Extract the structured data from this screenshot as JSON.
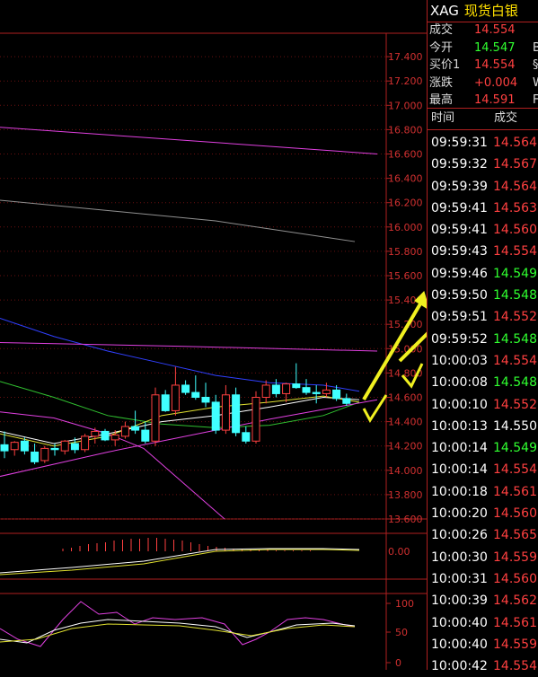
{
  "chart_data": {
    "type": "candlestick",
    "y_ticks": [
      "17.400",
      "17.200",
      "17.000",
      "16.800",
      "16.600",
      "16.400",
      "16.200",
      "16.000",
      "15.800",
      "15.600",
      "15.400",
      "15.200",
      "15.000",
      "14.800",
      "14.600",
      "14.400",
      "14.200",
      "14.000",
      "13.800",
      "13.600"
    ],
    "ylim": [
      13.6,
      17.5
    ],
    "candles": [
      {
        "o": 14.21,
        "h": 14.32,
        "l": 14.1,
        "c": 14.16
      },
      {
        "o": 14.17,
        "h": 14.24,
        "l": 14.12,
        "c": 14.23
      },
      {
        "o": 14.24,
        "h": 14.27,
        "l": 14.13,
        "c": 14.16
      },
      {
        "o": 14.15,
        "h": 14.22,
        "l": 14.05,
        "c": 14.07
      },
      {
        "o": 14.08,
        "h": 14.2,
        "l": 14.06,
        "c": 14.18
      },
      {
        "o": 14.18,
        "h": 14.22,
        "l": 14.12,
        "c": 14.17
      },
      {
        "o": 14.16,
        "h": 14.25,
        "l": 14.13,
        "c": 14.24
      },
      {
        "o": 14.22,
        "h": 14.27,
        "l": 14.14,
        "c": 14.17
      },
      {
        "o": 14.17,
        "h": 14.3,
        "l": 14.15,
        "c": 14.28
      },
      {
        "o": 14.28,
        "h": 14.35,
        "l": 14.22,
        "c": 14.32
      },
      {
        "o": 14.32,
        "h": 14.34,
        "l": 14.24,
        "c": 14.25
      },
      {
        "o": 14.25,
        "h": 14.33,
        "l": 14.2,
        "c": 14.29
      },
      {
        "o": 14.28,
        "h": 14.4,
        "l": 14.26,
        "c": 14.36
      },
      {
        "o": 14.36,
        "h": 14.49,
        "l": 14.3,
        "c": 14.33
      },
      {
        "o": 14.33,
        "h": 14.4,
        "l": 14.22,
        "c": 14.24
      },
      {
        "o": 14.24,
        "h": 14.68,
        "l": 14.2,
        "c": 14.62
      },
      {
        "o": 14.62,
        "h": 14.66,
        "l": 14.48,
        "c": 14.49
      },
      {
        "o": 14.49,
        "h": 14.85,
        "l": 14.45,
        "c": 14.7
      },
      {
        "o": 14.7,
        "h": 14.74,
        "l": 14.62,
        "c": 14.64
      },
      {
        "o": 14.64,
        "h": 14.78,
        "l": 14.58,
        "c": 14.6
      },
      {
        "o": 14.6,
        "h": 14.72,
        "l": 14.52,
        "c": 14.56
      },
      {
        "o": 14.56,
        "h": 14.62,
        "l": 14.3,
        "c": 14.33
      },
      {
        "o": 14.33,
        "h": 14.7,
        "l": 14.3,
        "c": 14.62
      },
      {
        "o": 14.62,
        "h": 14.68,
        "l": 14.28,
        "c": 14.31
      },
      {
        "o": 14.31,
        "h": 14.36,
        "l": 14.22,
        "c": 14.24
      },
      {
        "o": 14.24,
        "h": 14.65,
        "l": 14.22,
        "c": 14.6
      },
      {
        "o": 14.6,
        "h": 14.74,
        "l": 14.55,
        "c": 14.7
      },
      {
        "o": 14.7,
        "h": 14.75,
        "l": 14.6,
        "c": 14.63
      },
      {
        "o": 14.63,
        "h": 14.72,
        "l": 14.56,
        "c": 14.71
      },
      {
        "o": 14.71,
        "h": 14.88,
        "l": 14.67,
        "c": 14.68
      },
      {
        "o": 14.68,
        "h": 14.75,
        "l": 14.62,
        "c": 14.64
      },
      {
        "o": 14.64,
        "h": 14.7,
        "l": 14.55,
        "c": 14.63
      },
      {
        "o": 14.63,
        "h": 14.72,
        "l": 14.6,
        "c": 14.66
      },
      {
        "o": 14.66,
        "h": 14.7,
        "l": 14.57,
        "c": 14.59
      },
      {
        "o": 14.59,
        "h": 14.63,
        "l": 14.53,
        "c": 14.55
      }
    ],
    "ma_lines": [
      {
        "color": "#e040e0",
        "values": [
          [
            0,
            16.82
          ],
          [
            420,
            16.6
          ]
        ]
      },
      {
        "color": "#909090",
        "values": [
          [
            0,
            16.22
          ],
          [
            240,
            16.05
          ],
          [
            395,
            15.88
          ]
        ]
      },
      {
        "color": "#3040ff",
        "values": [
          [
            0,
            15.25
          ],
          [
            60,
            15.1
          ],
          [
            120,
            14.98
          ],
          [
            180,
            14.88
          ],
          [
            240,
            14.78
          ],
          [
            300,
            14.72
          ],
          [
            360,
            14.7
          ],
          [
            400,
            14.65
          ]
        ]
      },
      {
        "color": "#e040e0",
        "values": [
          [
            0,
            15.05
          ],
          [
            200,
            15.02
          ],
          [
            420,
            14.98
          ]
        ]
      },
      {
        "color": "#30c030",
        "values": [
          [
            0,
            14.73
          ],
          [
            60,
            14.6
          ],
          [
            120,
            14.45
          ],
          [
            180,
            14.38
          ],
          [
            240,
            14.35
          ],
          [
            300,
            14.37
          ],
          [
            360,
            14.45
          ],
          [
            400,
            14.56
          ]
        ]
      },
      {
        "color": "#ffffff",
        "values": [
          [
            0,
            14.32
          ],
          [
            60,
            14.22
          ],
          [
            120,
            14.3
          ],
          [
            180,
            14.4
          ],
          [
            240,
            14.45
          ],
          [
            300,
            14.52
          ],
          [
            360,
            14.6
          ],
          [
            400,
            14.58
          ]
        ]
      },
      {
        "color": "#e0e030",
        "values": [
          [
            0,
            14.3
          ],
          [
            60,
            14.2
          ],
          [
            120,
            14.28
          ],
          [
            180,
            14.45
          ],
          [
            240,
            14.52
          ],
          [
            300,
            14.56
          ],
          [
            360,
            14.61
          ],
          [
            400,
            14.56
          ]
        ]
      },
      {
        "color": "#e040e0",
        "values": [
          [
            0,
            14.48
          ],
          [
            60,
            14.43
          ],
          [
            120,
            14.3
          ],
          [
            160,
            14.18
          ],
          [
            250,
            13.6
          ]
        ]
      },
      {
        "color": "#e040e0",
        "values": [
          [
            0,
            13.95
          ],
          [
            120,
            14.15
          ],
          [
            240,
            14.33
          ],
          [
            300,
            14.42
          ],
          [
            360,
            14.5
          ],
          [
            420,
            14.58
          ]
        ]
      }
    ],
    "macd_ticks": [
      "0.00"
    ],
    "kdj_ticks": [
      "100",
      "50",
      "0"
    ]
  },
  "quote": {
    "code": "XAG",
    "name": "现货白银",
    "rows": [
      {
        "label": "成交",
        "value": "14.554",
        "cls": "red",
        "extra": ""
      },
      {
        "label": "今开",
        "value": "14.547",
        "cls": "green",
        "extra": "B"
      },
      {
        "label": "买价1",
        "value": "14.554",
        "cls": "red",
        "extra": "§"
      },
      {
        "label": "涨跌",
        "value": "+0.004",
        "cls": "red",
        "extra": "W"
      },
      {
        "label": "最高",
        "value": "14.591",
        "cls": "red",
        "extra": "F"
      }
    ]
  },
  "ticks_header": {
    "time": "时间",
    "price": "成交"
  },
  "ticks": [
    {
      "time": "09:59:31",
      "price": "14.564",
      "cls": "red"
    },
    {
      "time": "09:59:32",
      "price": "14.567",
      "cls": "red"
    },
    {
      "time": "09:59:39",
      "price": "14.564",
      "cls": "red"
    },
    {
      "time": "09:59:41",
      "price": "14.563",
      "cls": "red"
    },
    {
      "time": "09:59:41",
      "price": "14.560",
      "cls": "red"
    },
    {
      "time": "09:59:43",
      "price": "14.554",
      "cls": "red"
    },
    {
      "time": "09:59:46",
      "price": "14.549",
      "cls": "green"
    },
    {
      "time": "09:59:50",
      "price": "14.548",
      "cls": "green"
    },
    {
      "time": "09:59:51",
      "price": "14.552",
      "cls": "red"
    },
    {
      "time": "09:59:52",
      "price": "14.548",
      "cls": "green"
    },
    {
      "time": "10:00:03",
      "price": "14.554",
      "cls": "red"
    },
    {
      "time": "10:00:08",
      "price": "14.548",
      "cls": "green"
    },
    {
      "time": "10:00:10",
      "price": "14.552",
      "cls": "red"
    },
    {
      "time": "10:00:13",
      "price": "14.550",
      "cls": "white"
    },
    {
      "time": "10:00:14",
      "price": "14.549",
      "cls": "green"
    },
    {
      "time": "10:00:14",
      "price": "14.554",
      "cls": "red"
    },
    {
      "time": "10:00:18",
      "price": "14.561",
      "cls": "red"
    },
    {
      "time": "10:00:20",
      "price": "14.560",
      "cls": "red"
    },
    {
      "time": "10:00:26",
      "price": "14.565",
      "cls": "red"
    },
    {
      "time": "10:00:30",
      "price": "14.559",
      "cls": "red"
    },
    {
      "time": "10:00:31",
      "price": "14.560",
      "cls": "red"
    },
    {
      "time": "10:00:39",
      "price": "14.562",
      "cls": "red"
    },
    {
      "time": "10:00:40",
      "price": "14.561",
      "cls": "red"
    },
    {
      "time": "10:00:40",
      "price": "14.559",
      "cls": "red"
    },
    {
      "time": "10:00:42",
      "price": "14.554",
      "cls": "red"
    }
  ]
}
